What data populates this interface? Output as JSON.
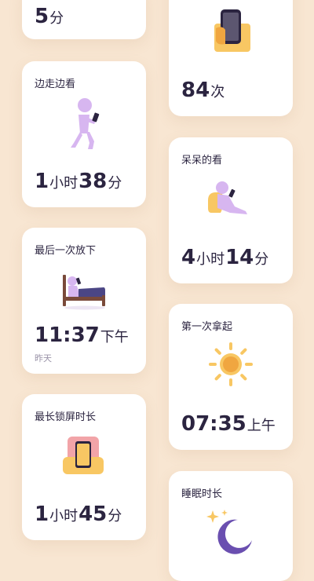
{
  "cards": {
    "top_partial": {
      "value": "5",
      "unit": "分"
    },
    "pickups": {
      "value": "84",
      "unit": "次"
    },
    "walking": {
      "title": "边走边看",
      "h": "1",
      "hu": "小时",
      "m": "38",
      "mu": "分"
    },
    "idle": {
      "title": "呆呆的看",
      "h": "4",
      "hu": "小时",
      "m": "14",
      "mu": "分"
    },
    "last_putdown": {
      "title": "最后一次放下",
      "time": "11:37",
      "period": "下午",
      "day": "昨天"
    },
    "first_pickup": {
      "title": "第一次拿起",
      "time": "07:35",
      "period": "上午"
    },
    "longest_lock": {
      "title": "最长锁屏时长",
      "h": "1",
      "hu": "小时",
      "m": "45",
      "mu": "分"
    },
    "sleep": {
      "title": "睡眠时长"
    }
  },
  "icons": {
    "walking": "person-walking-phone-icon",
    "idle": "person-reclining-phone-icon",
    "bed": "person-in-bed-phone-icon",
    "sun": "sun-icon",
    "lock": "phone-on-stand-icon",
    "hand": "hand-holding-phone-icon",
    "moon": "moon-stars-icon"
  },
  "colors": {
    "background": "#F8E6D2",
    "text": "#2B2440",
    "lavender": "#D7B6F0",
    "purple": "#6A4FB0",
    "yellow": "#F8C763",
    "orange": "#F0A640"
  }
}
